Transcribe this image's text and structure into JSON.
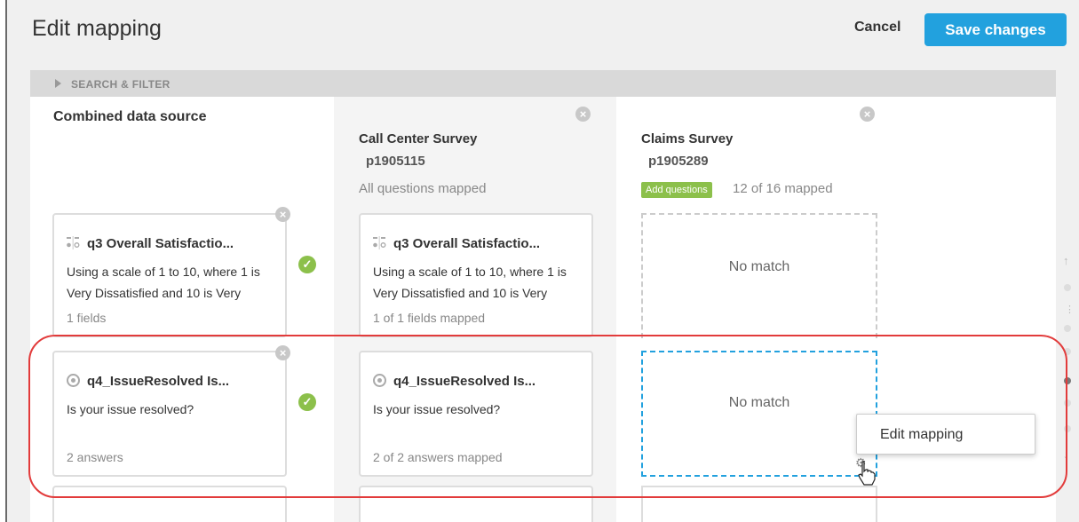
{
  "header": {
    "title": "Edit mapping",
    "cancel_label": "Cancel",
    "save_label": "Save changes"
  },
  "filter": {
    "label": "SEARCH & FILTER"
  },
  "columns": [
    {
      "title": "Combined data source"
    },
    {
      "title": "Call Center Survey",
      "id": "p1905115",
      "status": "All questions mapped"
    },
    {
      "title": "Claims Survey",
      "id": "p1905289",
      "add_label": "Add questions",
      "status": "12 of 16 mapped"
    }
  ],
  "rows": [
    {
      "combined": {
        "title": "q3 Overall Satisfactio...",
        "text": "Using a scale of 1 to 10, where 1 is Very Dissatisfied and 10 is Very",
        "footer": "1 fields"
      },
      "call": {
        "title": "q3 Overall Satisfactio...",
        "text": "Using a scale of 1 to 10, where 1 is Very Dissatisfied and 10 is Very",
        "footer": "1 of 1 fields mapped"
      },
      "claims": "No match"
    },
    {
      "combined": {
        "title": "q4_IssueResolved Is...",
        "text": "Is your issue resolved?",
        "footer": "2 answers"
      },
      "call": {
        "title": "q4_IssueResolved Is...",
        "text": "Is your issue resolved?",
        "footer": "2 of 2 answers mapped"
      },
      "claims": "No match"
    }
  ],
  "context_menu": {
    "item": "Edit mapping"
  },
  "icons": {
    "check": "✓",
    "close": "×",
    "up": "↑",
    "down": "↓",
    "gear": "⚙",
    "dots": "⋮"
  },
  "colors": {
    "accent": "#22a1de",
    "success": "#8cc04b",
    "highlight": "#e23b3b"
  }
}
